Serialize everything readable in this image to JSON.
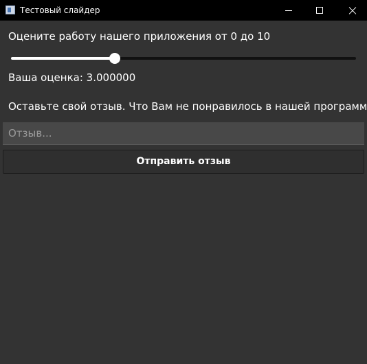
{
  "window": {
    "title": "Тестовый слайдер"
  },
  "main": {
    "rate_prompt": "Оцените работу нашего приложения от 0 до 10",
    "slider": {
      "min": 0,
      "max": 10,
      "value": 3
    },
    "score_text": "Ваша оценка: 3.000000",
    "feedback_prompt": "Оставьте свой отзыв. Что Вам не понравилось в нашей программе?",
    "feedback_input": {
      "value": "",
      "placeholder": "Отзыв..."
    },
    "submit_label": "Отправить отзыв"
  }
}
